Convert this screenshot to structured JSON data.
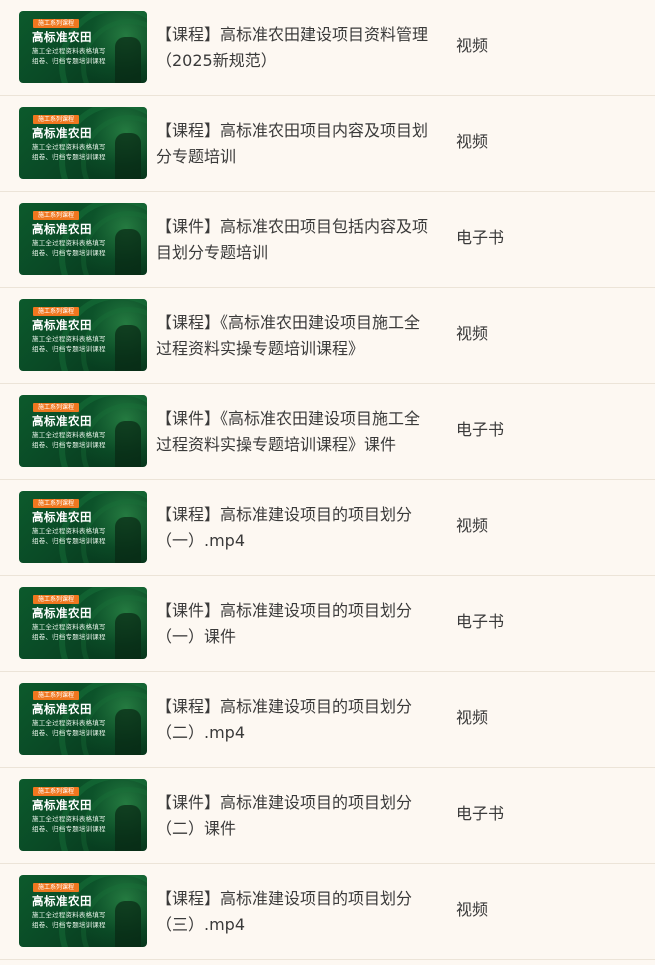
{
  "thumbnail": {
    "tag": "施工系列课程",
    "title": "高标准农田",
    "subtitle_line1": "施工全过程资料表格填写",
    "subtitle_line2": "组卷、归档专题培训课程"
  },
  "colors": {
    "background": "#fdf8f2",
    "text": "#3a3a3a",
    "divider": "#ece4d8",
    "thumb_green": "#0a4a26",
    "tag_orange": "#f0771f"
  },
  "items": [
    {
      "name": "【课程】高标准农田建设项目资料管理（2025新规范）",
      "type": "视频"
    },
    {
      "name": "【课程】高标准农田项目内容及项目划分专题培训",
      "type": "视频"
    },
    {
      "name": "【课件】高标准农田项目包括内容及项目划分专题培训",
      "type": "电子书"
    },
    {
      "name": "【课程】《高标准农田建设项目施工全过程资料实操专题培训课程》",
      "type": "视频"
    },
    {
      "name": "【课件】《高标准农田建设项目施工全过程资料实操专题培训课程》课件",
      "type": "电子书"
    },
    {
      "name": "【课程】高标准建设项目的项目划分（一）.mp4",
      "type": "视频"
    },
    {
      "name": "【课件】高标准建设项目的项目划分（一）课件",
      "type": "电子书"
    },
    {
      "name": "【课程】高标准建设项目的项目划分（二）.mp4",
      "type": "视频"
    },
    {
      "name": "【课件】高标准建设项目的项目划分（二）课件",
      "type": "电子书"
    },
    {
      "name": "【课程】高标准建设项目的项目划分（三）.mp4",
      "type": "视频"
    }
  ]
}
